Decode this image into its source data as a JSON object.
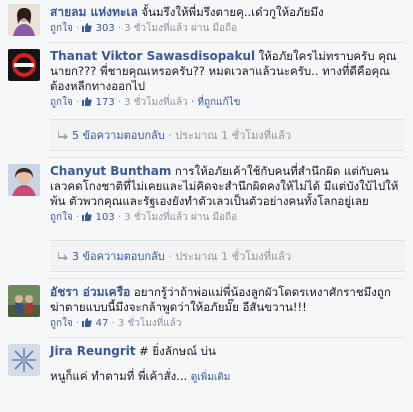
{
  "comments": [
    {
      "name": "สายลม แห่งทะเล",
      "text": "จั้นมรึงให้พี่มรึงตายคุ..เด๋วกูให้อภัยมึง",
      "meta": {
        "like": "ถูกใจ",
        "sep1": " · ",
        "count": "303",
        "time": " · 3 ชั่วโมงที่แล้ว ผ่าน มือถือ"
      }
    },
    {
      "name": "Thanat Viktor Sawasdisopakul",
      "text": "ให้อภัยใครไม่ทราบครับ คุณนายก??? พี่ชายคุณเหรอครับ?? หมดเวลาแล้วนะครับ.. ทางที่ดีคือคุณต้องหลีกทางออกไป",
      "meta": {
        "like": "ถูกใจ",
        "sep1": " · ",
        "count": "173",
        "time": " · 3 ชั่วโมงที่แล้ว",
        "extra": " · ที่ถูกแก้ไข"
      },
      "replies": {
        "label": "5 ข้อความตอบกลับ",
        "time": " · ประมาณ 1 ชั่วโมงที่แล้ว"
      }
    },
    {
      "name": "Chanyut Buntham",
      "text": "การให้อภัยเค้าใช้กับคนที่สำนึกผิด แต่กับคนเลวคดโกงชาติที่ไม่เคยและไม่คิดจะสำนึกผิดคงให้ไม่ได้ มีแต่บังใบ้ไปให้พ้น ตัวพวกคุณและรัฐเองยังทำตัวเลวเป็นตัวอย่างคนทั้งโลกอยู่เลย",
      "meta": {
        "like": "ถูกใจ",
        "sep1": " · ",
        "count": "103",
        "time": " · 3 ชั่วโมงที่แล้ว ผ่าน มือถือ"
      },
      "replies": {
        "label": "3 ข้อความตอบกลับ",
        "time": " · ประมาณ 1 ชั่วโมงที่แล้ว"
      }
    },
    {
      "name": "อัชรา อ่วมเครือ",
      "text": "อยากรู้ว่าถ้าพ่อแม่พี่น้องลูกผัวโดดรเหงาศักราชมึงถูกฆ่าตายแบบนี้มึงจะกล้าพูดว่าให้อภัยมั๊ย อีสันขวาน!!!",
      "meta": {
        "like": "ถูกใจ",
        "sep1": " · ",
        "count": "47",
        "time": " · 3 ชั่วโมงที่แล้ว"
      }
    },
    {
      "name": "Jira Reungrit",
      "text_prefix": "# ยิ่งลักษณ์ บ่น",
      "text": "หนูก็แค่ ทำตามที่ พี่เค้าสั่ง...",
      "more": "ดูเพิ่มเติม"
    }
  ],
  "colors": {
    "link": "#3b5998",
    "meta": "#90949c",
    "background": "#f6f7f9"
  }
}
